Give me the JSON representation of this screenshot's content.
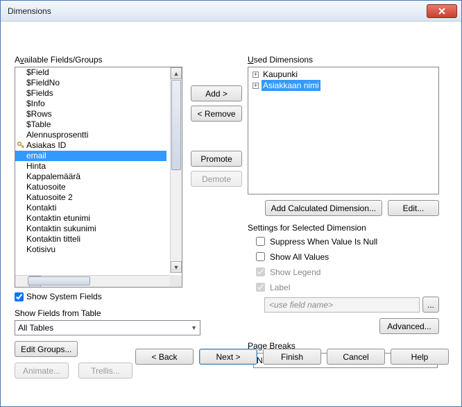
{
  "window": {
    "title": "Dimensions"
  },
  "left": {
    "label_pre": "A",
    "label_ul": "v",
    "label_post": "ailable Fields/Groups",
    "items": {
      "i0": "$Field",
      "i1": "$FieldNo",
      "i2": "$Fields",
      "i3": "$Info",
      "i4": "$Rows",
      "i5": "$Table",
      "i6": "Alennusprosentti",
      "i7": "Asiakas ID",
      "i8": "email",
      "i9": "Hinta",
      "i10": "Kappalemäärä",
      "i11": "Katuosoite",
      "i12": "Katuosoite 2",
      "i13": "Kontakti",
      "i14": "Kontaktin etunimi",
      "i15": "Kontaktin sukunimi",
      "i16": "Kontaktin titteli",
      "i17": "Kotisivu"
    },
    "show_system_ul": "S",
    "show_system_post": "how System Fields",
    "show_table_pre": "Sho",
    "show_table_ul": "w",
    "show_table_post": " Fields from Table",
    "table_combo": "All Tables",
    "edit_groups_ul": "E",
    "edit_groups_post": "dit Groups...",
    "animate": "Animate...",
    "trellis_pre": "Trell",
    "trellis_ul": "i",
    "trellis_post": "s..."
  },
  "mid": {
    "add_ul": "A",
    "add_post": "dd >",
    "remove": "< Remove",
    "promote_ul": "P",
    "promote_post": "romote",
    "demote_pre": "D",
    "demote_ul": "e",
    "demote_post": "mote"
  },
  "right": {
    "label_ul": "U",
    "label_post": "sed Dimensions",
    "tree": {
      "t0": "Kaupunki",
      "t1": "Asiakkaan nimi"
    },
    "add_calc": "Add Calculated Dimension...",
    "edit_pre": "Edi",
    "edit_ul": "t",
    "edit_post": "...",
    "settings_title": "Settings for Selected Dimension",
    "suppress": "Suppress When Value Is Null",
    "showall_pre": "S",
    "showall_ul": "h",
    "showall_post": "ow All Values",
    "legend_pre": "Show Le",
    "legend_ul": "g",
    "legend_post": "end",
    "label_cb_ul": "L",
    "label_cb_post": "abel",
    "label_placeholder": "<use field name>",
    "advanced_pre": "Adva",
    "advanced_ul": "n",
    "advanced_post": "ced...",
    "pagebreaks": "Page Breaks",
    "pagebreaks_val": "No Breaks"
  },
  "wizard": {
    "back": "< Back",
    "next": "Next >",
    "finish": "Finish",
    "cancel": "Cancel",
    "help": "Help"
  }
}
